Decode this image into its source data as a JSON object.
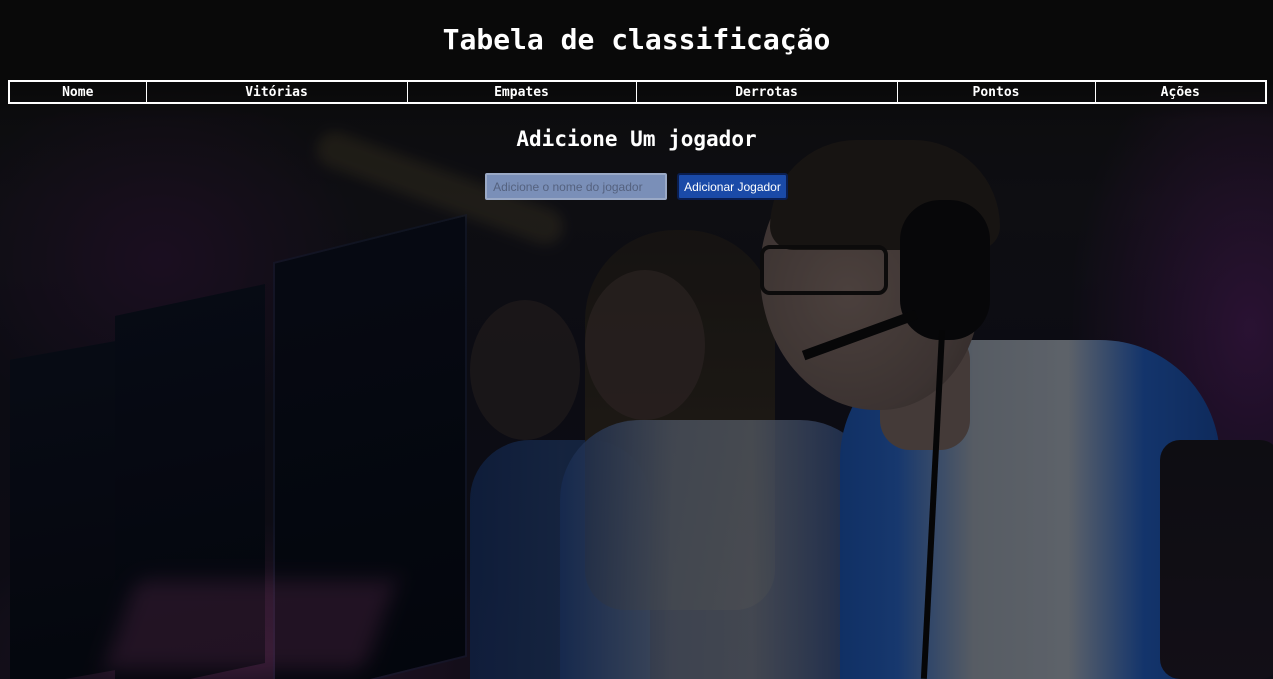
{
  "header": {
    "title": "Tabela de classificação"
  },
  "table": {
    "columns": [
      "Nome",
      "Vitórias",
      "Empates",
      "Derrotas",
      "Pontos",
      "Ações"
    ],
    "rows": []
  },
  "add_player": {
    "title": "Adicione Um jogador",
    "input_placeholder": "Adicione o nome do jogador",
    "input_value": "",
    "button_label": "Adicionar Jogador"
  },
  "background": {
    "image": "esports-players-at-computers"
  },
  "colors": {
    "page_bg": "#111111",
    "text": "#ffffff",
    "button_bg": "#1a4aa8",
    "input_bg": "#7a8fb8"
  }
}
